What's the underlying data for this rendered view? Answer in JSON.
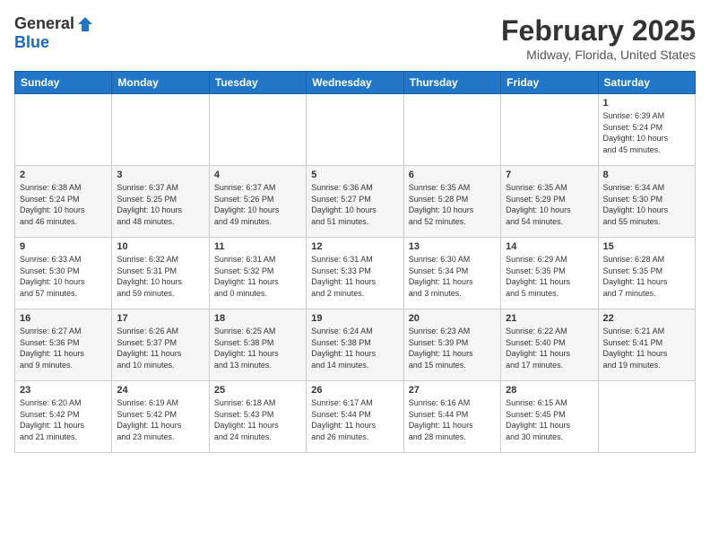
{
  "header": {
    "logo_general": "General",
    "logo_blue": "Blue",
    "month_title": "February 2025",
    "location": "Midway, Florida, United States"
  },
  "weekdays": [
    "Sunday",
    "Monday",
    "Tuesday",
    "Wednesday",
    "Thursday",
    "Friday",
    "Saturday"
  ],
  "weeks": [
    [
      {
        "day": "",
        "info": ""
      },
      {
        "day": "",
        "info": ""
      },
      {
        "day": "",
        "info": ""
      },
      {
        "day": "",
        "info": ""
      },
      {
        "day": "",
        "info": ""
      },
      {
        "day": "",
        "info": ""
      },
      {
        "day": "1",
        "info": "Sunrise: 6:39 AM\nSunset: 5:24 PM\nDaylight: 10 hours\nand 45 minutes."
      }
    ],
    [
      {
        "day": "2",
        "info": "Sunrise: 6:38 AM\nSunset: 5:24 PM\nDaylight: 10 hours\nand 46 minutes."
      },
      {
        "day": "3",
        "info": "Sunrise: 6:37 AM\nSunset: 5:25 PM\nDaylight: 10 hours\nand 48 minutes."
      },
      {
        "day": "4",
        "info": "Sunrise: 6:37 AM\nSunset: 5:26 PM\nDaylight: 10 hours\nand 49 minutes."
      },
      {
        "day": "5",
        "info": "Sunrise: 6:36 AM\nSunset: 5:27 PM\nDaylight: 10 hours\nand 51 minutes."
      },
      {
        "day": "6",
        "info": "Sunrise: 6:35 AM\nSunset: 5:28 PM\nDaylight: 10 hours\nand 52 minutes."
      },
      {
        "day": "7",
        "info": "Sunrise: 6:35 AM\nSunset: 5:29 PM\nDaylight: 10 hours\nand 54 minutes."
      },
      {
        "day": "8",
        "info": "Sunrise: 6:34 AM\nSunset: 5:30 PM\nDaylight: 10 hours\nand 55 minutes."
      }
    ],
    [
      {
        "day": "9",
        "info": "Sunrise: 6:33 AM\nSunset: 5:30 PM\nDaylight: 10 hours\nand 57 minutes."
      },
      {
        "day": "10",
        "info": "Sunrise: 6:32 AM\nSunset: 5:31 PM\nDaylight: 10 hours\nand 59 minutes."
      },
      {
        "day": "11",
        "info": "Sunrise: 6:31 AM\nSunset: 5:32 PM\nDaylight: 11 hours\nand 0 minutes."
      },
      {
        "day": "12",
        "info": "Sunrise: 6:31 AM\nSunset: 5:33 PM\nDaylight: 11 hours\nand 2 minutes."
      },
      {
        "day": "13",
        "info": "Sunrise: 6:30 AM\nSunset: 5:34 PM\nDaylight: 11 hours\nand 3 minutes."
      },
      {
        "day": "14",
        "info": "Sunrise: 6:29 AM\nSunset: 5:35 PM\nDaylight: 11 hours\nand 5 minutes."
      },
      {
        "day": "15",
        "info": "Sunrise: 6:28 AM\nSunset: 5:35 PM\nDaylight: 11 hours\nand 7 minutes."
      }
    ],
    [
      {
        "day": "16",
        "info": "Sunrise: 6:27 AM\nSunset: 5:36 PM\nDaylight: 11 hours\nand 9 minutes."
      },
      {
        "day": "17",
        "info": "Sunrise: 6:26 AM\nSunset: 5:37 PM\nDaylight: 11 hours\nand 10 minutes."
      },
      {
        "day": "18",
        "info": "Sunrise: 6:25 AM\nSunset: 5:38 PM\nDaylight: 11 hours\nand 13 minutes."
      },
      {
        "day": "19",
        "info": "Sunrise: 6:24 AM\nSunset: 5:38 PM\nDaylight: 11 hours\nand 14 minutes."
      },
      {
        "day": "20",
        "info": "Sunrise: 6:23 AM\nSunset: 5:39 PM\nDaylight: 11 hours\nand 15 minutes."
      },
      {
        "day": "21",
        "info": "Sunrise: 6:22 AM\nSunset: 5:40 PM\nDaylight: 11 hours\nand 17 minutes."
      },
      {
        "day": "22",
        "info": "Sunrise: 6:21 AM\nSunset: 5:41 PM\nDaylight: 11 hours\nand 19 minutes."
      }
    ],
    [
      {
        "day": "23",
        "info": "Sunrise: 6:20 AM\nSunset: 5:42 PM\nDaylight: 11 hours\nand 21 minutes."
      },
      {
        "day": "24",
        "info": "Sunrise: 6:19 AM\nSunset: 5:42 PM\nDaylight: 11 hours\nand 23 minutes."
      },
      {
        "day": "25",
        "info": "Sunrise: 6:18 AM\nSunset: 5:43 PM\nDaylight: 11 hours\nand 24 minutes."
      },
      {
        "day": "26",
        "info": "Sunrise: 6:17 AM\nSunset: 5:44 PM\nDaylight: 11 hours\nand 26 minutes."
      },
      {
        "day": "27",
        "info": "Sunrise: 6:16 AM\nSunset: 5:44 PM\nDaylight: 11 hours\nand 28 minutes."
      },
      {
        "day": "28",
        "info": "Sunrise: 6:15 AM\nSunset: 5:45 PM\nDaylight: 11 hours\nand 30 minutes."
      },
      {
        "day": "",
        "info": ""
      }
    ]
  ]
}
